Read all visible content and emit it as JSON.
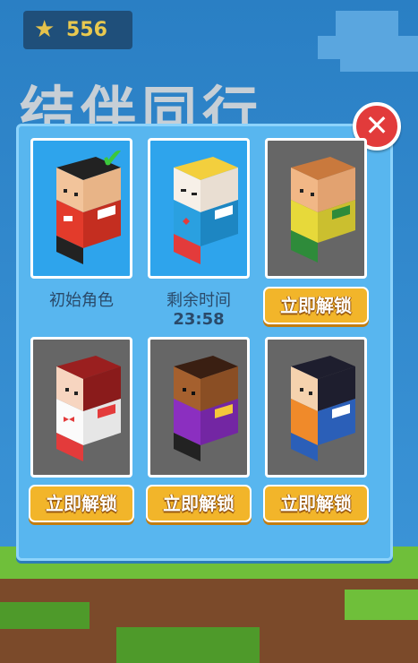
{
  "header": {
    "star_count": "556"
  },
  "background": {
    "title_text": "结伴同行"
  },
  "characters": [
    {
      "caption": "初始角色",
      "status": "selected"
    },
    {
      "caption": "剩余时间",
      "timer": "23:58"
    },
    {
      "button": "立即解锁"
    },
    {
      "button": "立即解锁"
    },
    {
      "button": "立即解锁"
    },
    {
      "button": "立即解锁"
    }
  ],
  "colors": {
    "panel": "#58b6ef",
    "button": "#f2b52a",
    "close": "#e23b3b"
  }
}
